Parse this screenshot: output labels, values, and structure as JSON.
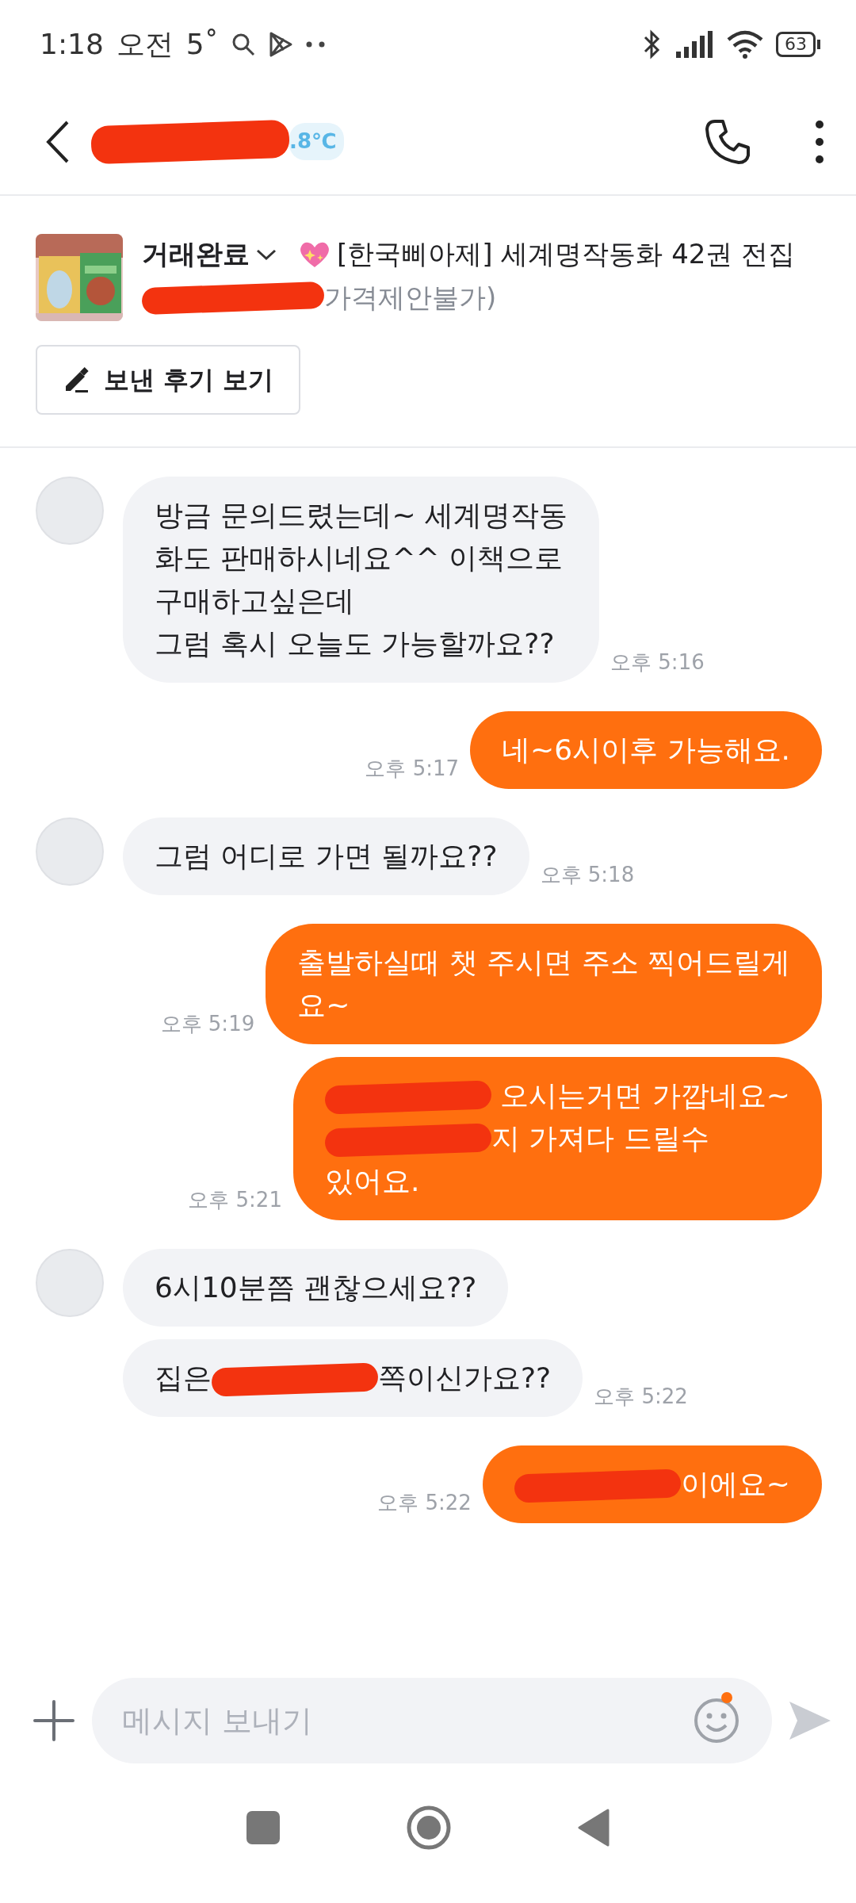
{
  "status_bar": {
    "time": "1:18",
    "ampm": "오전",
    "weather": "5˚",
    "battery": "63"
  },
  "header": {
    "title_parts": [
      {
        "kind": "redaction"
      }
    ],
    "temperature": ".8℃"
  },
  "product": {
    "status": "거래완료",
    "title": "[한국삐아제] 세계명작동화 42권 전집",
    "price_parts": [
      {
        "kind": "redaction"
      },
      {
        "kind": "text",
        "text": "가격제안불가)"
      }
    ],
    "review_button": "보낸 후기 보기"
  },
  "messages": [
    {
      "kind": "received",
      "avatar": true,
      "time": "오후 5:16",
      "lines": [
        [
          {
            "kind": "text",
            "text": "방금 문의드렸는데~ 세계명작동"
          }
        ],
        [
          {
            "kind": "text",
            "text": "화도 판매하시네요^^ 이책으로"
          }
        ],
        [
          {
            "kind": "text",
            "text": "구매하고싶은데"
          }
        ],
        [
          {
            "kind": "text",
            "text": "그럼 혹시 오늘도 가능할까요??"
          }
        ]
      ]
    },
    {
      "kind": "sent",
      "time": "오후 5:17",
      "lines": [
        [
          {
            "kind": "text",
            "text": "네~6시이후 가능해요."
          }
        ]
      ]
    },
    {
      "kind": "received",
      "avatar": true,
      "time": "오후 5:18",
      "lines": [
        [
          {
            "kind": "text",
            "text": "그럼 어디로 가면 될까요??"
          }
        ]
      ]
    },
    {
      "kind": "sent",
      "time": "오후 5:19",
      "lines": [
        [
          {
            "kind": "text",
            "text": "출발하실때 챗 주시면 주소 찍어드릴게"
          }
        ],
        [
          {
            "kind": "text",
            "text": "요~"
          }
        ]
      ]
    },
    {
      "kind": "sent",
      "time": "오후 5:21",
      "lines": [
        [
          {
            "kind": "redaction"
          },
          {
            "kind": "text",
            "text": " 오시는거면 가깝네요~"
          }
        ],
        [
          {
            "kind": "redaction"
          },
          {
            "kind": "text",
            "text": "지 가져다 드릴수"
          }
        ],
        [
          {
            "kind": "text",
            "text": "있어요."
          }
        ]
      ]
    },
    {
      "kind": "received",
      "avatar": true,
      "lines": [
        [
          {
            "kind": "text",
            "text": "6시10분쯤 괜찮으세요??"
          }
        ]
      ]
    },
    {
      "kind": "received",
      "avatar": false,
      "time": "오후 5:22",
      "lines": [
        [
          {
            "kind": "text",
            "text": "집은"
          },
          {
            "kind": "redaction"
          },
          {
            "kind": "text",
            "text": "쪽이신가요??"
          }
        ]
      ]
    },
    {
      "kind": "sent",
      "time": "오후 5:22",
      "lines": [
        [
          {
            "kind": "redaction"
          },
          {
            "kind": "text",
            "text": "이에요~"
          }
        ]
      ]
    }
  ],
  "composer": {
    "placeholder": "메시지 보내기",
    "emoji_badge": true
  }
}
